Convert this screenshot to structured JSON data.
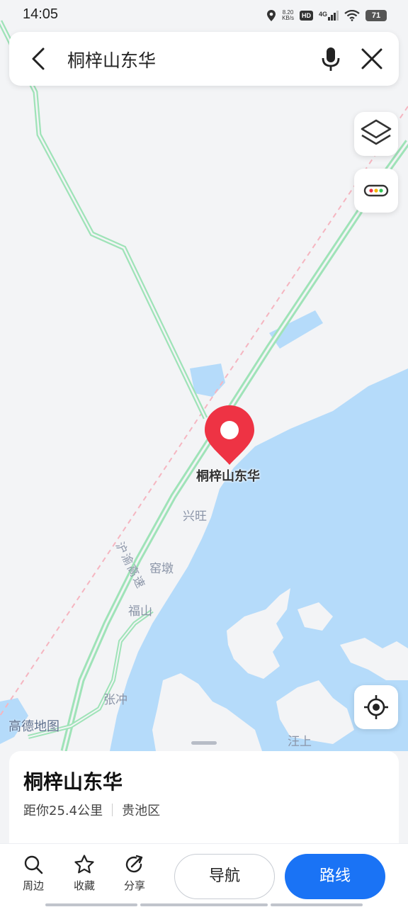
{
  "status_bar": {
    "time": "14:05",
    "net_speed_value": "8.20",
    "net_speed_unit": "KB/s",
    "hd": "HD",
    "network": "4G",
    "battery": "71"
  },
  "search": {
    "query": "桐梓山东华"
  },
  "map": {
    "pin_label": "桐梓山东华",
    "highway_label": "沪渝高速",
    "places": [
      "兴旺",
      "窑墩",
      "福山",
      "张冲",
      "汪上"
    ],
    "watermark": "高德地图",
    "water_color": "#b5dbfa",
    "road_color": "#9fe3b8",
    "pin_color": "#ee3344"
  },
  "place": {
    "name": "桐梓山东华",
    "distance": "距你25.4公里",
    "district": "贵池区"
  },
  "actions": {
    "nearby": "周边",
    "favorite": "收藏",
    "share": "分享",
    "navigate": "导航",
    "route": "路线"
  },
  "colors": {
    "accent": "#1a73f5"
  }
}
